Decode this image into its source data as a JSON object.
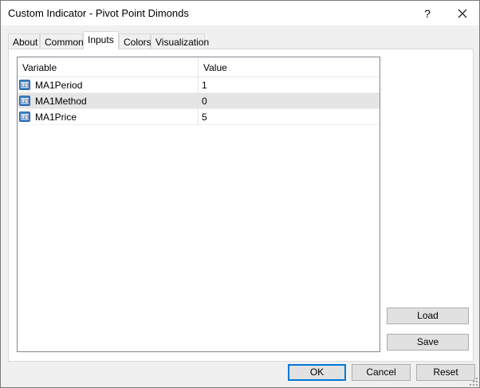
{
  "window": {
    "title": "Custom Indicator - Pivot Point Dimonds",
    "help_label": "?"
  },
  "tabs": [
    {
      "label": "About",
      "active": false
    },
    {
      "label": "Common",
      "active": false
    },
    {
      "label": "Inputs",
      "active": true
    },
    {
      "label": "Colors",
      "active": false
    },
    {
      "label": "Visualization",
      "active": false
    }
  ],
  "grid": {
    "columns": [
      "Variable",
      "Value"
    ],
    "rows": [
      {
        "variable": "MA1Period",
        "value": "1",
        "icon": "integer-type-icon",
        "icon_text": "123",
        "selected": false
      },
      {
        "variable": "MA1Method",
        "value": "0",
        "icon": "integer-type-icon",
        "icon_text": "123",
        "selected": true
      },
      {
        "variable": "MA1Price",
        "value": "5",
        "icon": "integer-type-icon",
        "icon_text": "123",
        "selected": false
      }
    ]
  },
  "buttons": {
    "load": "Load",
    "save": "Save",
    "ok": "OK",
    "cancel": "Cancel",
    "reset": "Reset"
  },
  "colors": {
    "accent": "#0078d7",
    "selected_row": "#e5e5e5",
    "dialog_bg": "#f0f0f0"
  }
}
